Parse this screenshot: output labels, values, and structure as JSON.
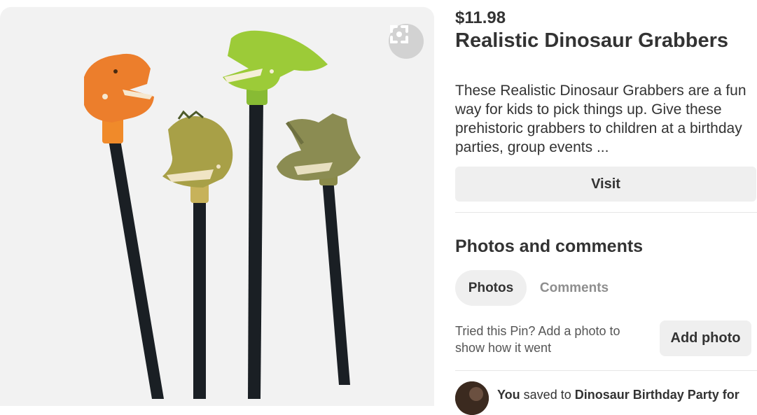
{
  "product": {
    "price": "$11.98",
    "title": "Realistic Dinosaur Grabbers",
    "description": "These Realistic Dinosaur Grabbers are a fun way for kids to pick things up. Give these prehistoric grabbers to children at a birthday parties, group events ...",
    "visit_label": "Visit",
    "image_alt_icon": "expand-icon"
  },
  "comments_section": {
    "title": "Photos and comments",
    "tabs": [
      {
        "label": "Photos",
        "active": true
      },
      {
        "label": "Comments",
        "active": false
      }
    ],
    "prompt": "Tried this Pin? Add a photo to show how it went",
    "add_photo_label": "Add photo"
  },
  "activity": {
    "user": "You",
    "action": " saved to ",
    "board": "Dinosaur Birthday Party for"
  },
  "colors": {
    "image_bg": "#f2f2f2",
    "button_bg": "#efefef",
    "text": "#333333",
    "muted": "#8e8e8e"
  }
}
